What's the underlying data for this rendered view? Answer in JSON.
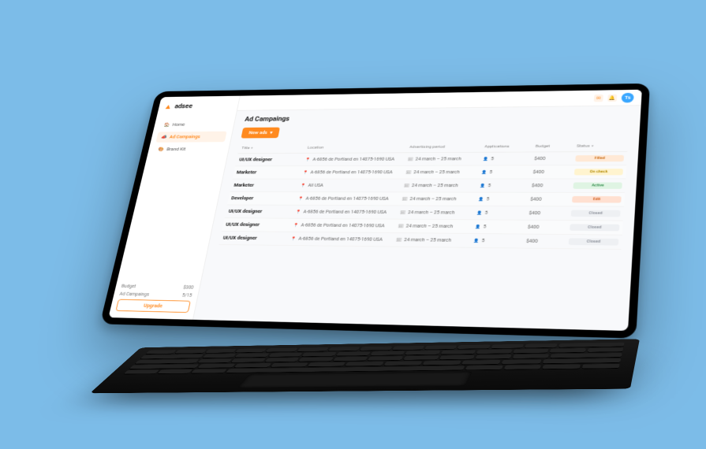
{
  "brand": {
    "name": "adsee"
  },
  "sidebar": {
    "items": [
      {
        "label": "Home"
      },
      {
        "label": "Ad Campaings"
      },
      {
        "label": "Brand Kit"
      }
    ],
    "stats": {
      "budget_label": "Budget",
      "budget_value": "$300",
      "camp_label": "Ad Campaings",
      "camp_value": "5/15"
    },
    "upgrade": "Upgrade"
  },
  "topbar": {
    "avatar_initials": "Ts"
  },
  "page": {
    "title": "Ad Campaings",
    "new_ads": "New ads"
  },
  "table": {
    "headers": {
      "title": "Title",
      "location": "Location",
      "period": "Advertising period",
      "applications": "Applications",
      "budget": "Budget",
      "status": "Status"
    },
    "rows": [
      {
        "title": "UI/UX designer",
        "location": "A-6856 de Portland en 14075-1690 USA",
        "period": "24 march – 25 march",
        "apps": "5",
        "budget": "$400",
        "status": "Filled",
        "status_class": "filled"
      },
      {
        "title": "Marketer",
        "location": "A-6856 de Portland en 14075-1690 USA",
        "period": "24 march – 25 march",
        "apps": "5",
        "budget": "$400",
        "status": "On check",
        "status_class": "on-check"
      },
      {
        "title": "Marketer",
        "location": "All USA",
        "period": "24 march – 25 march",
        "apps": "5",
        "budget": "$400",
        "status": "Active",
        "status_class": "active"
      },
      {
        "title": "Developer",
        "location": "A-6856 de Portland en 14075-1690 USA",
        "period": "24 march – 25 march",
        "apps": "5",
        "budget": "$400",
        "status": "Edit",
        "status_class": "edit"
      },
      {
        "title": "UI/UX designer",
        "location": "A-6856 de Portland en 14075-1690 USA",
        "period": "24 march – 25 march",
        "apps": "5",
        "budget": "$400",
        "status": "Closed",
        "status_class": "closed"
      },
      {
        "title": "UI/UX designer",
        "location": "A-6856 de Portland en 14075-1690 USA",
        "period": "24 march – 25 march",
        "apps": "5",
        "budget": "$400",
        "status": "Closed",
        "status_class": "closed"
      },
      {
        "title": "UI/UX designer",
        "location": "A-6856 de Portland en 14075-1690 USA",
        "period": "24 march – 25 march",
        "apps": "5",
        "budget": "$400",
        "status": "Closed",
        "status_class": "closed"
      }
    ]
  }
}
